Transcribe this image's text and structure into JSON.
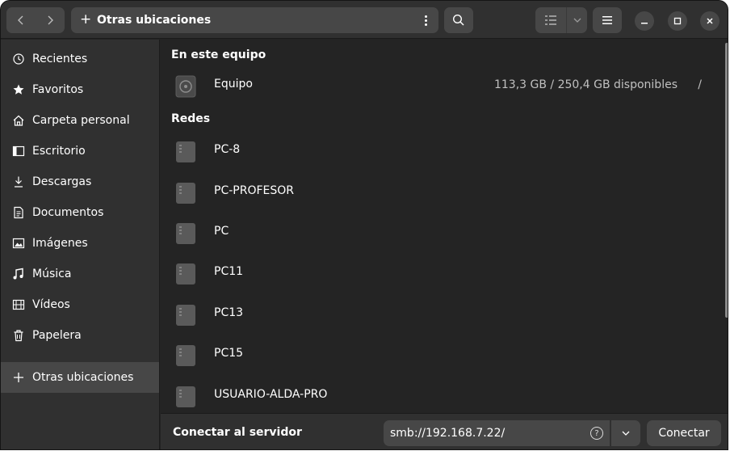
{
  "header": {
    "path_label": "Otras ubicaciones",
    "path_icon": "plus-icon"
  },
  "sidebar": {
    "items": [
      {
        "label": "Recientes",
        "icon": "clock-icon"
      },
      {
        "label": "Favoritos",
        "icon": "star-icon"
      },
      {
        "label": "Carpeta personal",
        "icon": "home-icon"
      },
      {
        "label": "Escritorio",
        "icon": "desktop-icon"
      },
      {
        "label": "Descargas",
        "icon": "download-icon"
      },
      {
        "label": "Documentos",
        "icon": "document-icon"
      },
      {
        "label": "Imágenes",
        "icon": "image-icon"
      },
      {
        "label": "Música",
        "icon": "music-icon"
      },
      {
        "label": "Vídeos",
        "icon": "video-icon"
      },
      {
        "label": "Papelera",
        "icon": "trash-icon"
      },
      {
        "label": "Otras ubicaciones",
        "icon": "plus-icon",
        "active": true
      }
    ]
  },
  "main": {
    "local_section": "En este equipo",
    "local_items": [
      {
        "name": "Equipo",
        "info": "113,3 GB / 250,4 GB disponibles",
        "path": "/"
      }
    ],
    "network_section": "Redes",
    "network_items": [
      {
        "name": "PC-8"
      },
      {
        "name": "PC-PROFESOR"
      },
      {
        "name": "PC"
      },
      {
        "name": "PC11"
      },
      {
        "name": "PC13"
      },
      {
        "name": "PC15"
      },
      {
        "name": "USUARIO-ALDA-PRO"
      }
    ]
  },
  "footer": {
    "connect_label": "Conectar al servidor",
    "server_value": "smb://192.168.7.22/",
    "connect_button": "Conectar"
  },
  "colors": {
    "window_bg": "#242424",
    "bar_bg": "#303030",
    "button_bg": "#474747",
    "text": "#ffffff",
    "muted_text": "#c0c0c0"
  }
}
